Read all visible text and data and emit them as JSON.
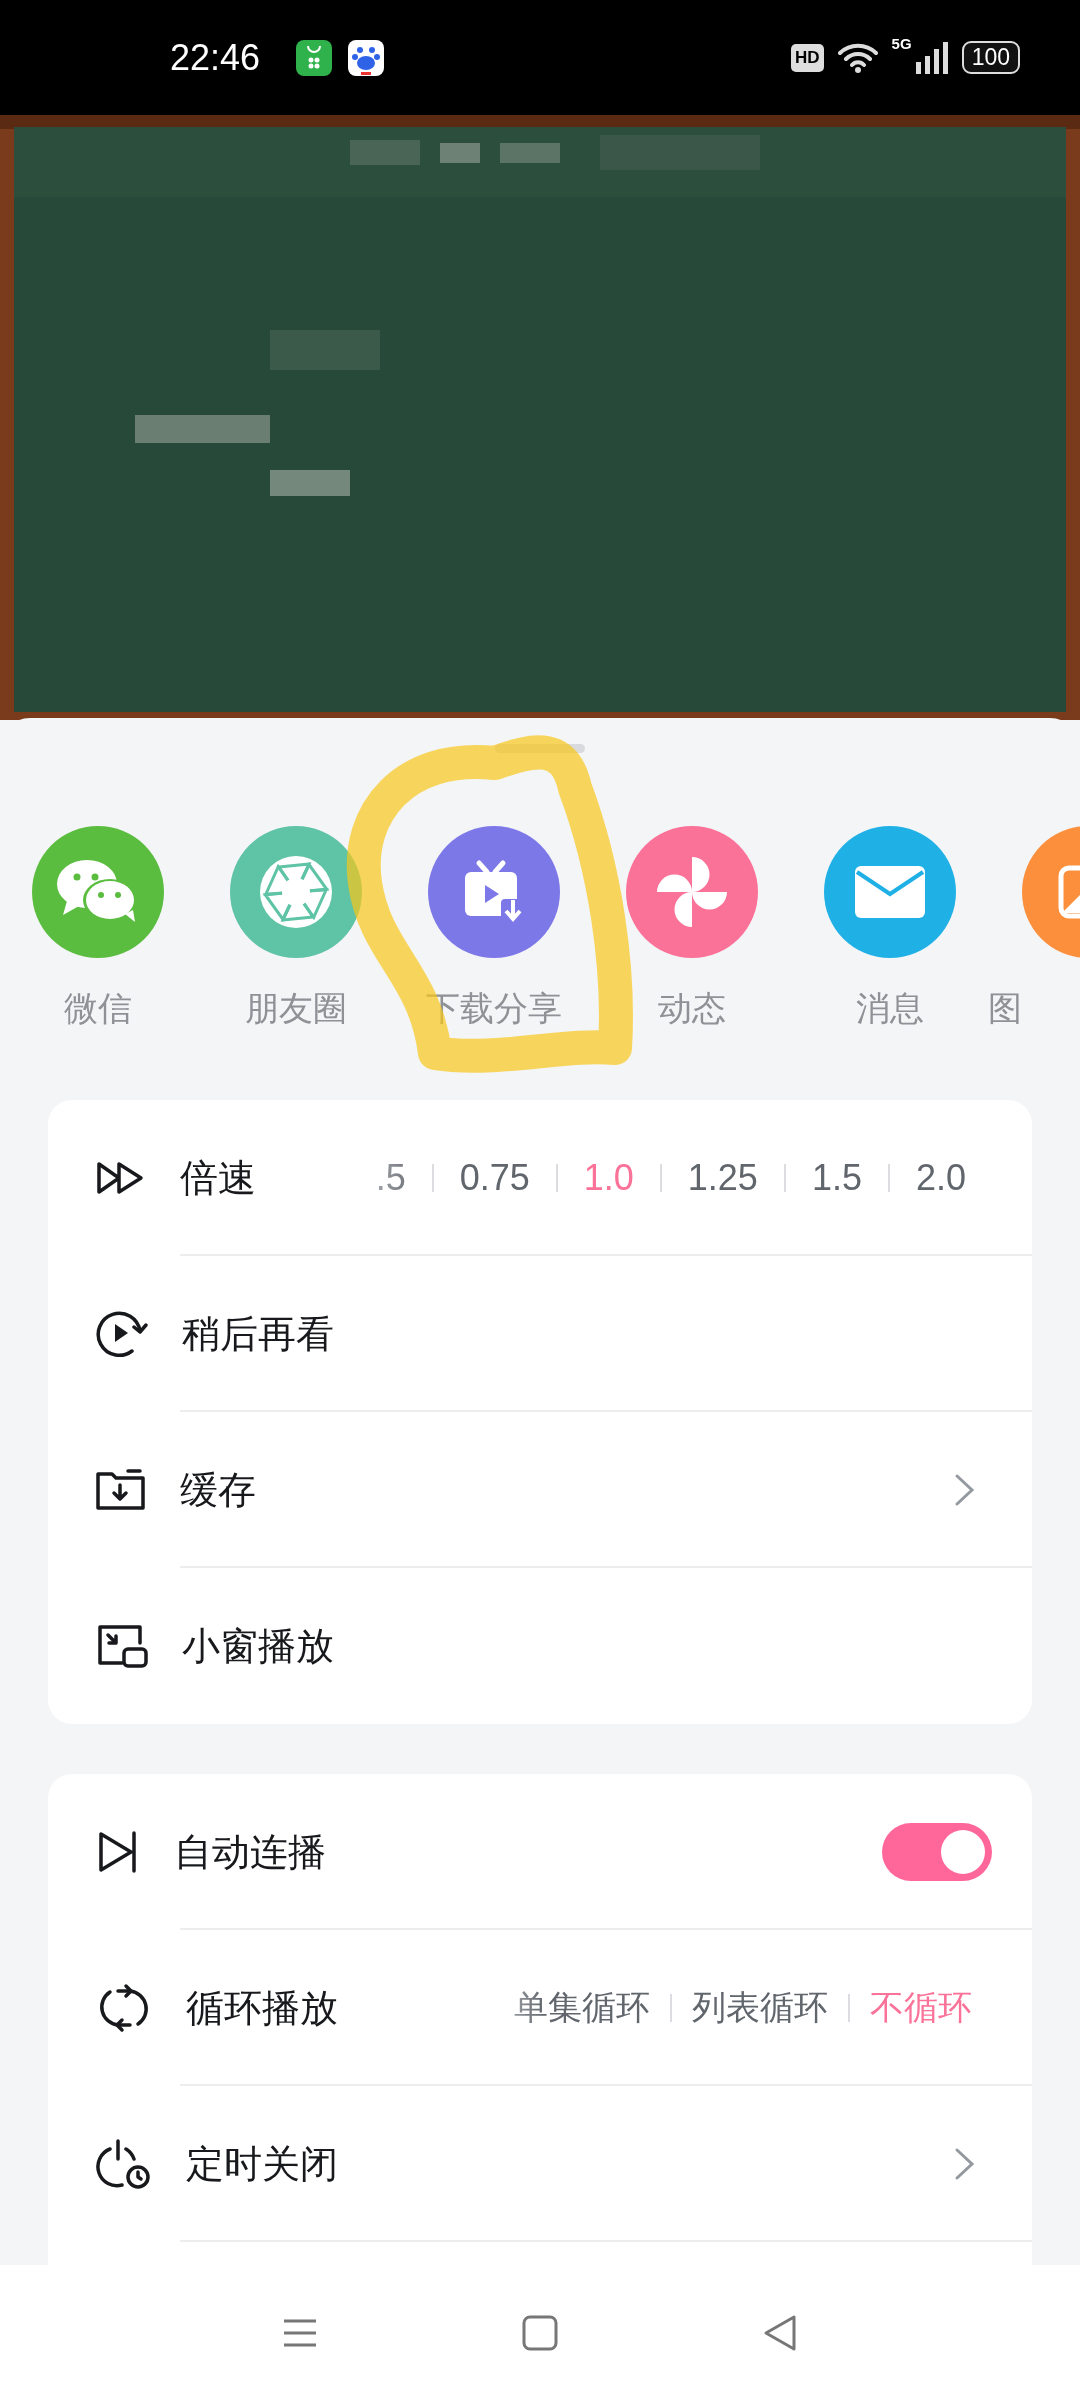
{
  "status_bar": {
    "time": "22:46",
    "hd": "HD",
    "network": "5G",
    "battery": "100"
  },
  "share": [
    {
      "label": "微信",
      "color": "#5bbd3f"
    },
    {
      "label": "朋友圈",
      "color": "#5fc3a5"
    },
    {
      "label": "下载分享",
      "color": "#7d78e8"
    },
    {
      "label": "动态",
      "color": "#fb7299"
    },
    {
      "label": "消息",
      "color": "#1fb0e6"
    },
    {
      "label": "图",
      "color": "#fb8f3c"
    }
  ],
  "cards": [
    {
      "rows": [
        {
          "kind": "speed",
          "label": "倍速",
          "options": [
            {
              "label": ".5",
              "selected": false
            },
            {
              "label": "0.75",
              "selected": false
            },
            {
              "label": "1.0",
              "selected": true
            },
            {
              "label": "1.25",
              "selected": false
            },
            {
              "label": "1.5",
              "selected": false
            },
            {
              "label": "2.0",
              "selected": false
            }
          ]
        },
        {
          "kind": "action",
          "label": "稍后再看"
        },
        {
          "kind": "link",
          "label": "缓存"
        },
        {
          "kind": "action",
          "label": "小窗播放"
        }
      ]
    },
    {
      "rows": [
        {
          "kind": "toggle",
          "label": "自动连播",
          "on": true
        },
        {
          "kind": "loop",
          "label": "循环播放",
          "options": [
            {
              "label": "单集循环",
              "selected": false
            },
            {
              "label": "列表循环",
              "selected": false
            },
            {
              "label": "不循环",
              "selected": true
            }
          ]
        },
        {
          "kind": "link",
          "label": "定时关闭"
        }
      ]
    }
  ]
}
